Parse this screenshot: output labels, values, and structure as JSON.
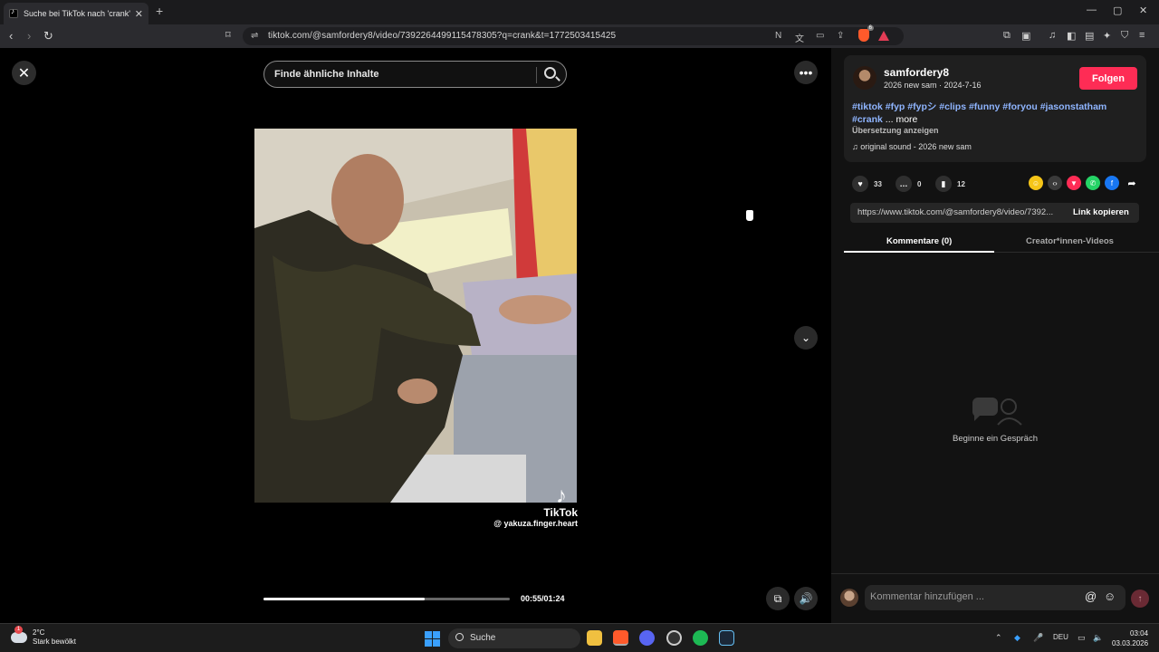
{
  "browser": {
    "tab_title": "Suche bei TikTok nach 'crank'",
    "tab_close": "✕",
    "new_tab": "+",
    "url": "tiktok.com/@samfordery8/video/7392264499115478305?q=crank&t=1772503415425",
    "window_controls": [
      "—",
      "▢",
      "✕"
    ],
    "brave_badge": "6"
  },
  "video": {
    "search_placeholder": "Finde ähnliche Inhalte",
    "watermark_brand": "TikTok",
    "watermark_user": "@ yakuza.finger.heart",
    "time": "00:55/01:24",
    "progress_fraction": 0.655
  },
  "author": {
    "username": "samfordery8",
    "subtitle": "2026 new sam · 2024-7-16",
    "follow_label": "Folgen"
  },
  "description": {
    "hashtags": "#tiktok #fyp #fypシ #clips #funny #foryou #jasonstatham #crank",
    "more": "... more",
    "translate": "Übersetzung anzeigen",
    "sound": "original sound - 2026 new sam"
  },
  "stats": {
    "likes": "33",
    "comments": "0",
    "saves": "12"
  },
  "share": {
    "link": "https://www.tiktok.com/@samfordery8/video/7392...",
    "copy_label": "Link kopieren"
  },
  "tabs": {
    "comments": "Kommentare (0)",
    "creator_videos": "Creator*innen-Videos"
  },
  "empty_state": "Beginne ein Gespräch",
  "comment_input": {
    "placeholder": "Kommentar hinzufügen ..."
  },
  "taskbar": {
    "temperature": "2°C",
    "weather": "Stark bewölkt",
    "weather_badge": "1",
    "search_label": "Suche",
    "language": "DEU",
    "time": "03:04",
    "date": "03.03.2026"
  },
  "colors": {
    "accent": "#fe2c55",
    "hashtag": "#8fb5ff"
  }
}
